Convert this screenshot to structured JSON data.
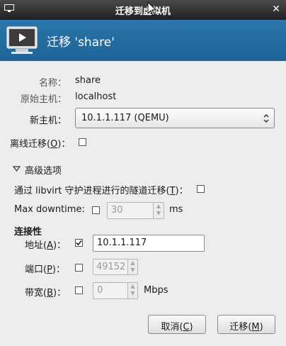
{
  "window": {
    "title": "迁移到虚拟机",
    "close_glyph": "✕"
  },
  "banner": {
    "title": "迁移 'share'"
  },
  "form": {
    "name_label": "名称：",
    "name_value": "share",
    "orig_host_label": "原始主机：",
    "orig_host_value": "localhost",
    "new_host_label": "新主机：",
    "new_host_value": "10.1.1.117 (QEMU)",
    "offline_label_pre": "离线迁移(",
    "offline_key": "O",
    "offline_label_post": ")：",
    "offline_checked": false
  },
  "advanced": {
    "expander_label": "高级选项",
    "tunnel_label_pre": "通过 libvirt 守护进程进行的隧道迁移(",
    "tunnel_key": "T",
    "tunnel_label_post": ")：",
    "tunnel_checked": false,
    "downtime_label": "Max downtime:",
    "downtime_checked": false,
    "downtime_value": "30",
    "downtime_unit": "ms",
    "connectivity_header": "连接性",
    "address_label_pre": "地址(",
    "address_key": "A",
    "address_label_post": ")：",
    "address_checked": true,
    "address_value": "10.1.1.117",
    "port_label_pre": "端口(",
    "port_key": "P",
    "port_label_post": ")：",
    "port_checked": false,
    "port_value": "49152",
    "bandwidth_label_pre": "带宽(",
    "bandwidth_key": "B",
    "bandwidth_label_post": ")：",
    "bandwidth_checked": false,
    "bandwidth_value": "0",
    "bandwidth_unit": "Mbps"
  },
  "buttons": {
    "cancel_pre": "取消(",
    "cancel_key": "C",
    "cancel_post": ")",
    "migrate_pre": "迁移(",
    "migrate_key": "M",
    "migrate_post": ")"
  },
  "colors": {
    "banner": "#1e6398",
    "titlebar": "#2b2b2b",
    "background": "#ededed"
  }
}
